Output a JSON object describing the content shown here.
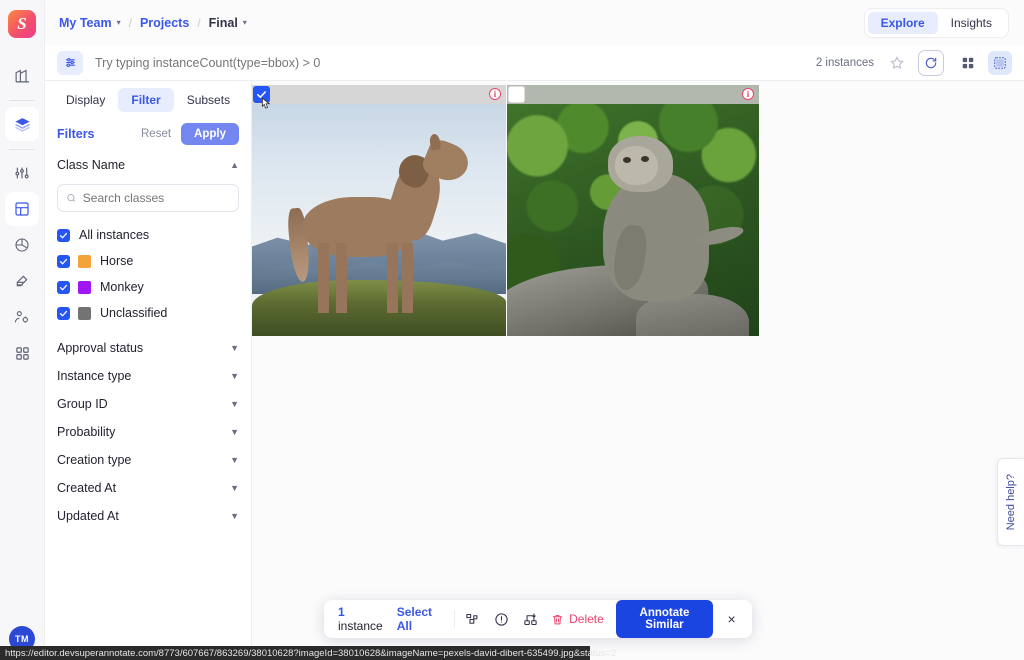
{
  "app": {
    "logo_letter": "S",
    "user_avatar_initials": "TM"
  },
  "rail": {
    "items": [
      {
        "name": "organization-icon",
        "label": "Organization"
      },
      {
        "name": "layers-icon",
        "label": "Projects",
        "active": true
      },
      {
        "name": "sliders-icon",
        "label": "Settings"
      },
      {
        "name": "grid-icon",
        "label": "Data",
        "active": true
      },
      {
        "name": "model-icon",
        "label": "Models"
      },
      {
        "name": "tools-icon",
        "label": "Tools"
      },
      {
        "name": "team-settings-icon",
        "label": "Team"
      },
      {
        "name": "apps-icon",
        "label": "Apps"
      }
    ]
  },
  "header": {
    "breadcrumb": {
      "team": "My Team",
      "projects": "Projects",
      "current": "Final",
      "separator": "/"
    },
    "segmented": {
      "explore": "Explore",
      "insights": "Insights",
      "active": "Explore"
    }
  },
  "search": {
    "placeholder": "Try typing instanceCount(type=bbox) > 0",
    "value": "",
    "instances_count": "2 instances",
    "icons": {
      "filter_toggle": "sliders-icon",
      "favorite": "star-icon",
      "refresh": "refresh-icon",
      "grid_view": "grid-view-icon",
      "panel_view": "panel-view-icon"
    }
  },
  "panel": {
    "tabs": [
      {
        "label": "Display",
        "active": false
      },
      {
        "label": "Filter",
        "active": true
      },
      {
        "label": "Subsets",
        "active": false
      }
    ],
    "filters_title": "Filters",
    "reset_label": "Reset",
    "apply_label": "Apply",
    "class_name": {
      "title": "Class Name",
      "expanded": true,
      "search_placeholder": "Search classes",
      "search_value": "",
      "classes": [
        {
          "label": "All instances",
          "checked": true,
          "color": null
        },
        {
          "label": "Horse",
          "checked": true,
          "color": "#F2A33C"
        },
        {
          "label": "Monkey",
          "checked": true,
          "color": "#A117F2"
        },
        {
          "label": "Unclassified",
          "checked": true,
          "color": "#737373"
        }
      ]
    },
    "sections": [
      {
        "label": "Approval status",
        "expanded": false
      },
      {
        "label": "Instance type",
        "expanded": false
      },
      {
        "label": "Group ID",
        "expanded": false
      },
      {
        "label": "Probability",
        "expanded": false
      },
      {
        "label": "Creation type",
        "expanded": false
      },
      {
        "label": "Created At",
        "expanded": false
      },
      {
        "label": "Updated At",
        "expanded": false
      }
    ]
  },
  "grid": {
    "cards": [
      {
        "name": "horse-instance-card",
        "checked": true,
        "info": "i",
        "alt": "Horse standing on grassy ridge with mountains"
      },
      {
        "name": "monkey-instance-card",
        "checked": false,
        "info": "i",
        "alt": "Monkey sitting on rock in front of green foliage"
      }
    ]
  },
  "need_help": {
    "label": "Need help?"
  },
  "action_bar": {
    "count_number": "1",
    "count_label": " instance",
    "select_all": "Select All",
    "icons": [
      {
        "name": "duplicate-shapes-icon"
      },
      {
        "name": "exclamation-circle-icon"
      },
      {
        "name": "group-download-icon"
      }
    ],
    "delete_label": "Delete",
    "annotate_similar_label": "Annotate Similar",
    "close_label": "×"
  },
  "status_bar": {
    "url": "https://editor.devsuperannotate.com/8773/607667/863269/38010628?imageId=38010628&imageName=pexels-david-dibert-635499.jpg&status=2"
  },
  "colors": {
    "accent_blue": "#2556F5",
    "link_blue": "#3A57E8",
    "apply_purple": "#7487F0",
    "danger": "#E8456E",
    "annotate_blue": "#1B45E0"
  }
}
